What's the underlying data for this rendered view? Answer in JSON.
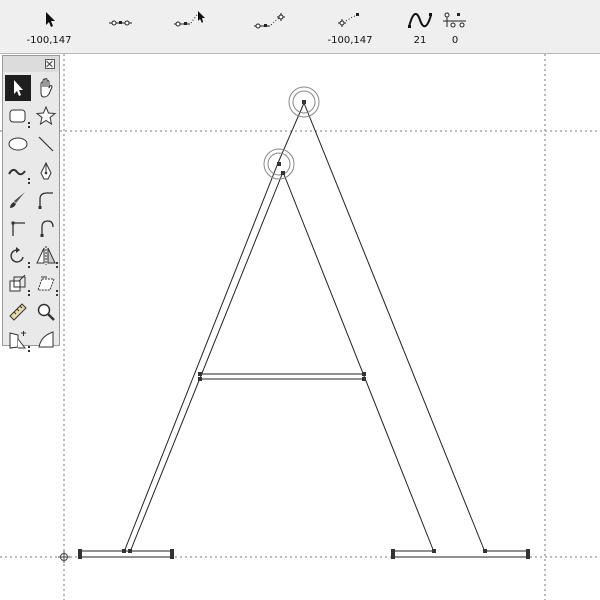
{
  "toolbar": {
    "items": [
      {
        "name": "pointer-position",
        "icon": "pointer-arrow-icon",
        "value": "-100,147"
      },
      {
        "name": "node-smooth",
        "icon": "node-smooth-icon",
        "value": ""
      },
      {
        "name": "node-add",
        "icon": "node-add-icon",
        "value": ""
      },
      {
        "name": "node-move",
        "icon": "node-move-icon",
        "value": ""
      },
      {
        "name": "node-position",
        "icon": "node-position-icon",
        "value": "-100,147"
      },
      {
        "name": "curve-value",
        "icon": "curve-icon",
        "value": "21"
      },
      {
        "name": "node-count",
        "icon": "node-tools-icon",
        "value": "0"
      }
    ]
  },
  "toolbox": {
    "tools": [
      "pointer-tool-icon",
      "hand-tool-icon",
      "rounded-rect-tool-icon",
      "star-tool-icon",
      "ellipse-tool-icon",
      "line-tool-icon",
      "freehand-tool-icon",
      "pen-tool-icon",
      "brush-tool-icon",
      "curve-tool-icon",
      "corner-tool-icon",
      "smooth-corner-tool-icon",
      "rotate-tool-icon",
      "mirror-tool-icon",
      "scale-tool-icon",
      "skew-tool-icon",
      "measure-tool-icon",
      "zoom-tool-icon",
      "perspective-tool-icon",
      "knife-tool-icon"
    ]
  },
  "colors": {
    "guide": "#777777",
    "path": "#222222",
    "node": "#333333",
    "active_tool_bg": "#1e1e1e",
    "toolbar_bg": "#efefef"
  }
}
